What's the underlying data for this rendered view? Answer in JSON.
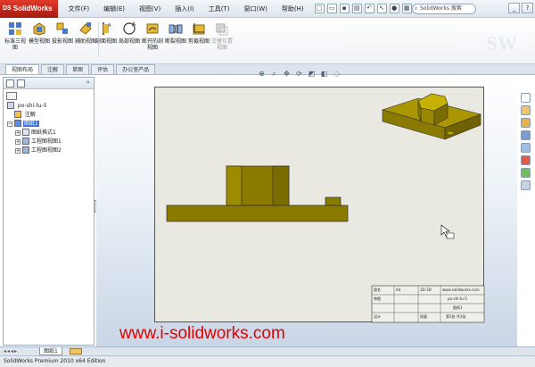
{
  "app": {
    "brand": "SolidWorks",
    "ds": "DS"
  },
  "menu": [
    {
      "label": "文件(F)"
    },
    {
      "label": "编辑(E)"
    },
    {
      "label": "视图(V)"
    },
    {
      "label": "插入(I)"
    },
    {
      "label": "工具(T)"
    },
    {
      "label": "窗口(W)"
    },
    {
      "label": "帮助(H)"
    }
  ],
  "search": {
    "placeholder": "SolidWorks 搜索"
  },
  "ribbon": {
    "buttons": [
      {
        "label": "标准三视图",
        "icon": "standard-3view-icon",
        "dim": false
      },
      {
        "label": "模型视图",
        "icon": "model-view-icon",
        "dim": false
      },
      {
        "label": "投影视图",
        "icon": "projected-view-icon",
        "dim": false
      },
      {
        "label": "辅助视图",
        "icon": "auxiliary-view-icon",
        "dim": false
      },
      {
        "label": "剖面视图",
        "icon": "section-view-icon",
        "dim": false
      },
      {
        "label": "局部视图",
        "icon": "detail-view-icon",
        "dim": false
      },
      {
        "label": "断开的剖视图",
        "icon": "broken-out-section-icon",
        "dim": false
      },
      {
        "label": "断裂视图",
        "icon": "break-view-icon",
        "dim": false
      },
      {
        "label": "剪裁视图",
        "icon": "crop-view-icon",
        "dim": false
      },
      {
        "label": "交替位置视图",
        "icon": "alternate-position-view-icon",
        "dim": true
      }
    ]
  },
  "tabs": [
    {
      "label": "视图布局",
      "active": true
    },
    {
      "label": "注解",
      "active": false
    },
    {
      "label": "草图",
      "active": false
    },
    {
      "label": "评估",
      "active": false
    },
    {
      "label": "办公室产品",
      "active": false
    }
  ],
  "tree": {
    "root": "po-shi-tu-5",
    "items": [
      {
        "label": "注解",
        "level": 1,
        "selected": false,
        "expand": false
      },
      {
        "label": "图纸1",
        "level": 1,
        "selected": true,
        "expand": true
      },
      {
        "label": "图纸格式1",
        "level": 2,
        "selected": false,
        "expand": true
      },
      {
        "label": "工程图视图1",
        "level": 2,
        "selected": false,
        "expand": true
      },
      {
        "label": "工程图视图2",
        "level": 2,
        "selected": false,
        "expand": true
      }
    ]
  },
  "title_block": {
    "row1": [
      "图名",
      "A4",
      "2D-3D",
      "www.solidworks.com"
    ],
    "row2": [
      "审图",
      "",
      "",
      "po-shi-tu-5"
    ],
    "row3": [
      "",
      "",
      "",
      "图纸1"
    ],
    "row4": [
      "设计",
      "",
      "质量",
      "第1张 共1张"
    ]
  },
  "watermark_url": "www.i-solidworks.com",
  "sheet_tab": {
    "label": "图纸1"
  },
  "status": {
    "text": "SolidWorks Premium 2010 x64 Edition"
  },
  "colors": {
    "part": "#8a7a00",
    "part_dark": "#5d5200",
    "brand": "#c8261a"
  }
}
